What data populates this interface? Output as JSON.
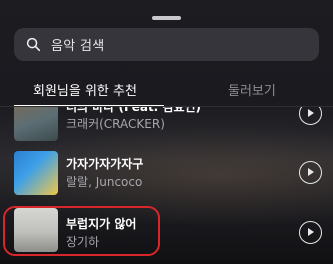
{
  "search": {
    "placeholder": "음악 검색"
  },
  "tabs": [
    {
      "label": "회원님을 위한 추천",
      "selected": true
    },
    {
      "label": "둘러보기",
      "selected": false
    }
  ],
  "songs": [
    {
      "title": "너의 바다 (Feat. 김효연)",
      "artist": "크래커(CRACKER)"
    },
    {
      "title": "가자가자가자구",
      "artist": "랄랄, Juncoco"
    },
    {
      "title": "부럽지가 않어",
      "artist": "장기하"
    }
  ],
  "colors": {
    "highlight": "#d8262b",
    "tab_active": "#ffffff",
    "tab_inactive": "#8d8d92"
  }
}
